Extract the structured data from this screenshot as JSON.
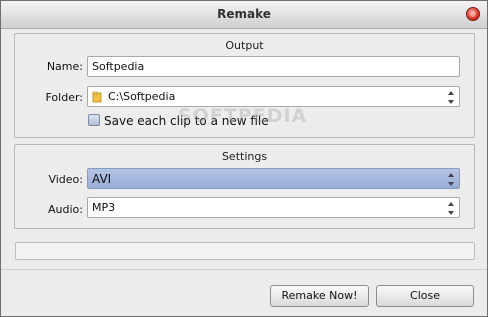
{
  "window": {
    "title": "Remake"
  },
  "output": {
    "title": "Output",
    "name_label": "Name:",
    "name_value": "Softpedia",
    "folder_label": "Folder:",
    "folder_value": "C:\\Softpedia",
    "checkbox_label": "Save each clip to a new file",
    "checkbox_checked": false
  },
  "watermark": "SOFTPEDIA",
  "settings": {
    "title": "Settings",
    "video_label": "Video:",
    "video_value": "AVI",
    "audio_label": "Audio:",
    "audio_value": "MP3"
  },
  "progress": {
    "value": 0
  },
  "buttons": {
    "remake": "Remake Now!",
    "close": "Close"
  }
}
